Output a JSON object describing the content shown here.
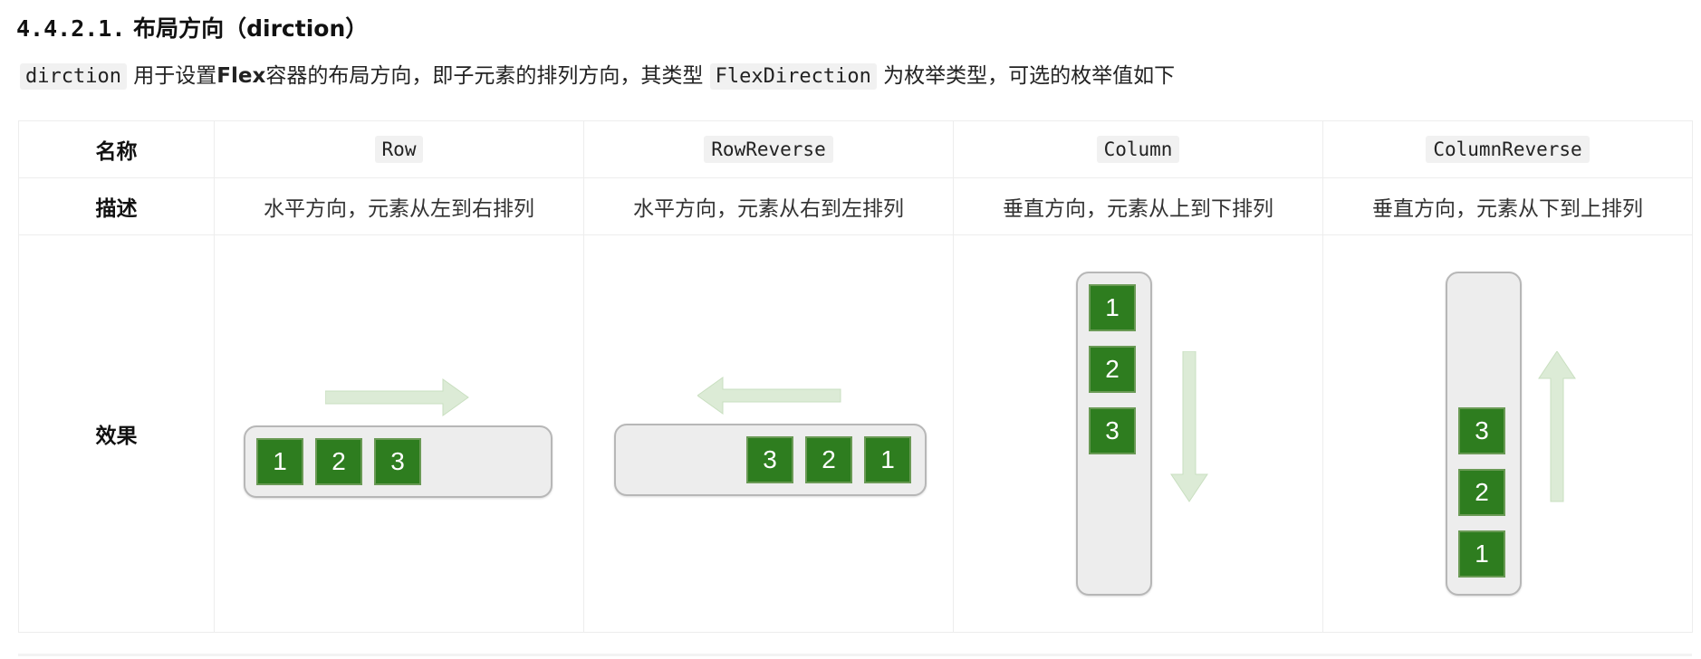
{
  "heading": {
    "number": "4.4.2.1.",
    "title": "布局方向（dirction）"
  },
  "intro": {
    "code1": "dirction",
    "text1": " 用于设置",
    "bold": "Flex",
    "text2": "容器的布局方向，即子元素的排列方向，其类型 ",
    "code2": "FlexDirection",
    "text3": " 为枚举类型，可选的枚举值如下"
  },
  "table": {
    "row_labels": {
      "name": "名称",
      "desc": "描述",
      "effect": "效果"
    },
    "columns": [
      {
        "name": "Row",
        "desc": "水平方向，元素从左到右排列",
        "boxes": [
          "1",
          "2",
          "3"
        ]
      },
      {
        "name": "RowReverse",
        "desc": "水平方向，元素从右到左排列",
        "boxes": [
          "3",
          "2",
          "1"
        ]
      },
      {
        "name": "Column",
        "desc": "垂直方向，元素从上到下排列",
        "boxes": [
          "1",
          "2",
          "3"
        ]
      },
      {
        "name": "ColumnReverse",
        "desc": "垂直方向，元素从下到上排列",
        "boxes": [
          "3",
          "2",
          "1"
        ]
      }
    ]
  },
  "colors": {
    "box": "#2e7d1f",
    "arrow": "#dcebd6",
    "container": "#ededed"
  }
}
